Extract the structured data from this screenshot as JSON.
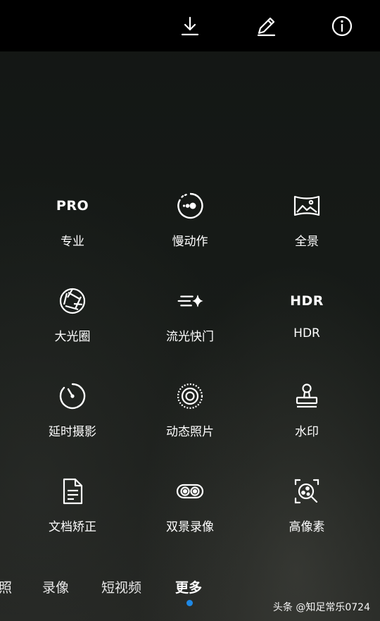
{
  "topbar": {
    "icons": [
      "download-icon",
      "edit-icon",
      "info-icon"
    ]
  },
  "modes_grid": {
    "items": [
      {
        "label": "专业",
        "icon": "pro-text-icon",
        "icon_text": "PRO"
      },
      {
        "label": "慢动作",
        "icon": "slow-motion-icon"
      },
      {
        "label": "全景",
        "icon": "panorama-icon"
      },
      {
        "label": "大光圈",
        "icon": "aperture-icon"
      },
      {
        "label": "流光快门",
        "icon": "light-painting-icon"
      },
      {
        "label": "HDR",
        "icon": "hdr-text-icon",
        "icon_text": "HDR"
      },
      {
        "label": "延时摄影",
        "icon": "timelapse-icon"
      },
      {
        "label": "动态照片",
        "icon": "moving-picture-icon"
      },
      {
        "label": "水印",
        "icon": "stamp-icon"
      },
      {
        "label": "文档矫正",
        "icon": "document-icon"
      },
      {
        "label": "双景录像",
        "icon": "dual-view-icon"
      },
      {
        "label": "高像素",
        "icon": "high-res-icon"
      }
    ]
  },
  "mode_bar": {
    "items": [
      {
        "label": "照",
        "active": false
      },
      {
        "label": "录像",
        "active": false
      },
      {
        "label": "短视频",
        "active": false
      },
      {
        "label": "更多",
        "active": true
      }
    ],
    "indicator_color": "#1e88e5"
  },
  "watermark": {
    "text": "头条 @知足常乐0724"
  }
}
